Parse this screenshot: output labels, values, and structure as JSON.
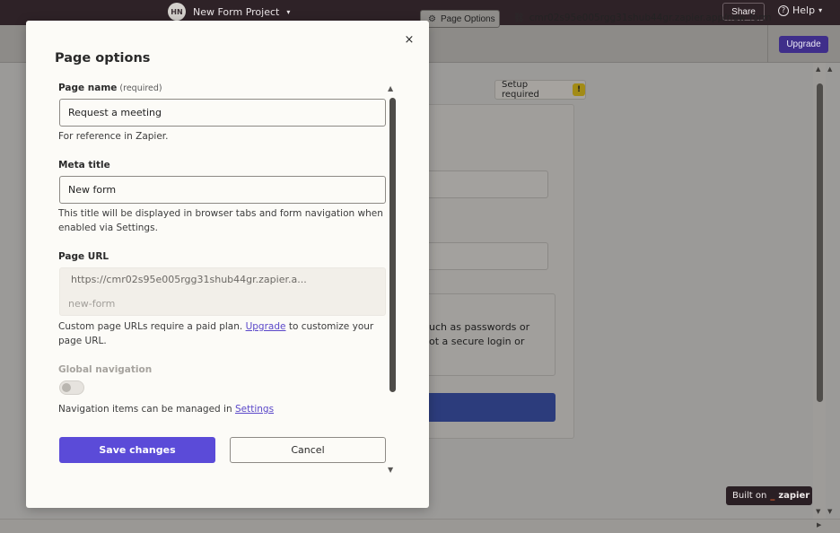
{
  "header": {
    "avatar_initials": "HN",
    "project_name": "New Form Project",
    "share_label": "Share",
    "help_label": "Help"
  },
  "toolbar": {
    "page_options_label": "Page Options",
    "page_url": "cmr02s95e005rgg31shub44gr.zapier.app/new-form",
    "upgrade_label": "Upgrade"
  },
  "canvas": {
    "setup_badge": "Setup required",
    "ghost_line_1": "uch as passwords or",
    "ghost_line_2": "ot a secure login or",
    "built_on_label": "Built on",
    "built_on_brand_dash": "_",
    "built_on_brand": "zapier"
  },
  "modal": {
    "title": "Page options",
    "page_name_label": "Page name",
    "page_name_required": "(required)",
    "page_name_value": "Request a meeting",
    "page_name_help": "For reference in Zapier.",
    "meta_title_label": "Meta title",
    "meta_title_value": "New form",
    "meta_title_help": "This title will be displayed in browser tabs and form navigation when enabled via Settings.",
    "page_url_label": "Page URL",
    "page_url_full": "https://cmr02s95e005rgg31shub44gr.zapier.a...",
    "page_url_slug": "new-form",
    "page_url_help_before": "Custom page URLs require a paid plan.",
    "page_url_help_link": "Upgrade",
    "page_url_help_after": "to customize your page URL.",
    "global_nav_label": "Global navigation",
    "global_nav_enabled": false,
    "nav_help_before": "Navigation items can be managed in",
    "nav_help_link": "Settings",
    "save_label": "Save changes",
    "cancel_label": "Cancel"
  },
  "icons": {
    "caret": "▾",
    "help": "?",
    "link": "🔗",
    "warning": "!",
    "close": "×",
    "scroll_up": "▲",
    "scroll_down": "▼",
    "scroll_right": "▶"
  },
  "colors": {
    "header_bg": "#2e2227",
    "primary": "#5b4bd8",
    "link": "#5a47c9",
    "upgrade_bg": "#3f2e8a",
    "zapier_orange": "#e8632f"
  }
}
